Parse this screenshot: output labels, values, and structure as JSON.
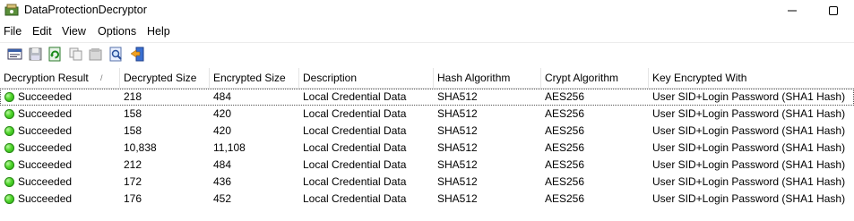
{
  "window": {
    "title": "DataProtectionDecryptor"
  },
  "menu": [
    "File",
    "Edit",
    "View",
    "Options",
    "Help"
  ],
  "toolbar_icons": [
    "properties-icon",
    "save-icon",
    "refresh-icon",
    "copy-icon",
    "html-report-icon",
    "find-icon",
    "exit-icon"
  ],
  "columns": [
    "Decryption Result",
    "Decrypted Size",
    "Encrypted Size",
    "Description",
    "Hash Algorithm",
    "Crypt Algorithm",
    "Key Encrypted With"
  ],
  "sort_indicator": "/",
  "status_color": "#3cc21f",
  "rows": [
    [
      "Succeeded",
      "218",
      "484",
      "Local Credential Data",
      "SHA512",
      "AES256",
      "User SID+Login Password (SHA1 Hash)"
    ],
    [
      "Succeeded",
      "158",
      "420",
      "Local Credential Data",
      "SHA512",
      "AES256",
      "User SID+Login Password (SHA1 Hash)"
    ],
    [
      "Succeeded",
      "158",
      "420",
      "Local Credential Data",
      "SHA512",
      "AES256",
      "User SID+Login Password (SHA1 Hash)"
    ],
    [
      "Succeeded",
      "10,838",
      "11,108",
      "Local Credential Data",
      "SHA512",
      "AES256",
      "User SID+Login Password (SHA1 Hash)"
    ],
    [
      "Succeeded",
      "212",
      "484",
      "Local Credential Data",
      "SHA512",
      "AES256",
      "User SID+Login Password (SHA1 Hash)"
    ],
    [
      "Succeeded",
      "172",
      "436",
      "Local Credential Data",
      "SHA512",
      "AES256",
      "User SID+Login Password (SHA1 Hash)"
    ],
    [
      "Succeeded",
      "176",
      "452",
      "Local Credential Data",
      "SHA512",
      "AES256",
      "User SID+Login Password (SHA1 Hash)"
    ]
  ]
}
